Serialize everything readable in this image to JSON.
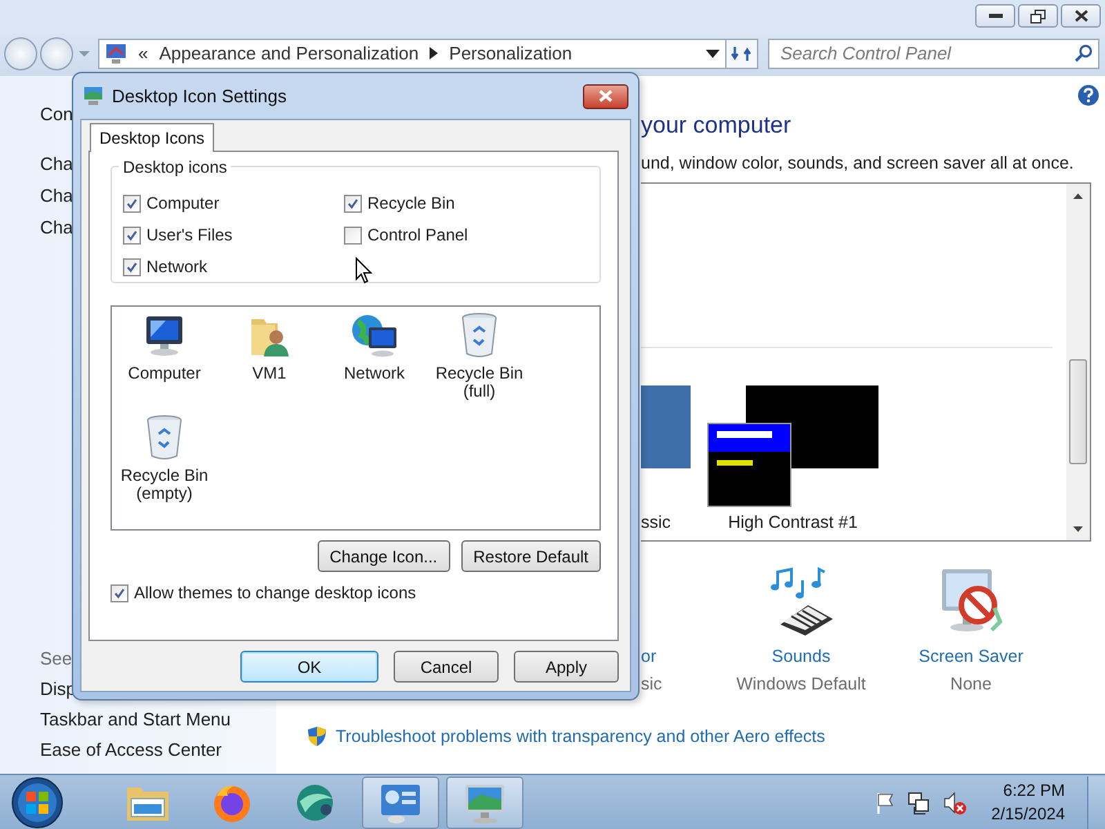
{
  "address_bar": {
    "overflow": "«",
    "crumbs": [
      "Appearance and Personalization",
      "Personalization"
    ]
  },
  "search": {
    "placeholder": "Search Control Panel"
  },
  "sidebar": {
    "items": [
      "Con",
      "Cha",
      "Cha",
      "Cha"
    ],
    "see_also_heading": "See",
    "see_also": [
      "Disp",
      "Taskbar and Start Menu",
      "Ease of Access Center"
    ]
  },
  "main": {
    "heading": "your computer",
    "description": "und, window color, sounds, and screen saver all at once.",
    "themes": [
      {
        "name": "ssic",
        "kind": "classic"
      },
      {
        "name": "High Contrast #1",
        "kind": "high-contrast"
      }
    ],
    "settings": [
      {
        "label": "or",
        "value": "sic",
        "kind": "color"
      },
      {
        "label": "Sounds",
        "value": "Windows Default",
        "kind": "sounds"
      },
      {
        "label": "Screen Saver",
        "value": "None",
        "kind": "screensaver"
      }
    ],
    "troubleshoot_link": "Troubleshoot problems with transparency and other Aero effects"
  },
  "dialog": {
    "title": "Desktop Icon Settings",
    "tabs": [
      {
        "label": "Desktop Icons",
        "selected": true
      }
    ],
    "group_title": "Desktop icons",
    "options": [
      {
        "label": "Computer",
        "checked": true
      },
      {
        "label": "Recycle Bin",
        "checked": true
      },
      {
        "label": "User's Files",
        "checked": true
      },
      {
        "label": "Control Panel",
        "checked": false
      },
      {
        "label": "Network",
        "checked": true
      }
    ],
    "icons": [
      {
        "label": "Computer",
        "kind": "computer"
      },
      {
        "label": "VM1",
        "kind": "user-folder"
      },
      {
        "label": "Network",
        "kind": "network"
      },
      {
        "label": "Recycle Bin (full)",
        "kind": "bin"
      },
      {
        "label": "Recycle Bin (empty)",
        "kind": "bin"
      }
    ],
    "icon_buttons": [
      "Change Icon...",
      "Restore Default"
    ],
    "allow_themes": {
      "label": "Allow themes to change desktop icons",
      "checked": true
    },
    "buttons": [
      {
        "label": "OK",
        "default": true
      },
      {
        "label": "Cancel",
        "default": false
      },
      {
        "label": "Apply",
        "default": false
      }
    ]
  },
  "taskbar": {
    "apps": [
      {
        "kind": "explorer",
        "active": false
      },
      {
        "kind": "firefox",
        "active": false
      },
      {
        "kind": "globe",
        "active": false
      },
      {
        "kind": "control-panel",
        "active": true
      },
      {
        "kind": "display",
        "active": true
      }
    ],
    "clock": {
      "time": "6:22 PM",
      "date": "2/15/2024"
    }
  }
}
